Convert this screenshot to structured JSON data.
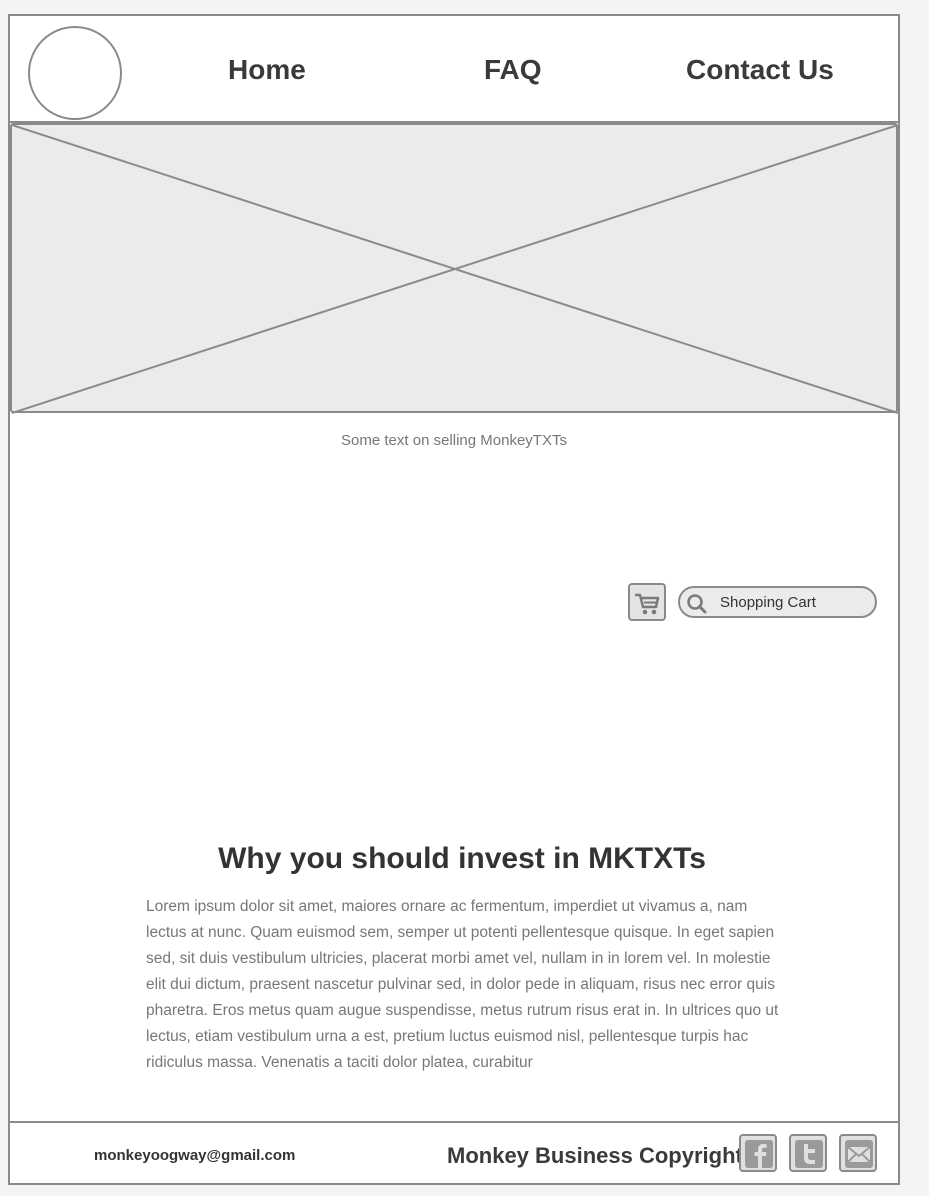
{
  "nav": {
    "items": [
      {
        "label": "Home"
      },
      {
        "label": "FAQ"
      },
      {
        "label": "Contact Us"
      }
    ]
  },
  "hero": {
    "caption": "Some text on selling MonkeyTXTs"
  },
  "shop": {
    "search_value": "Shopping Cart",
    "icons": [
      "shopping-cart-icon",
      "search-icon"
    ]
  },
  "main": {
    "heading": "Why you should invest in MKTXTs",
    "body": "Lorem ipsum dolor sit amet, maiores ornare ac fermentum, imperdiet ut vivamus a, nam lectus at nunc. Quam euismod sem, semper ut potenti pellentesque quisque. In eget sapien sed, sit duis vestibulum ultricies, placerat morbi amet vel, nullam in in lorem vel. In molestie elit dui dictum, praesent nascetur pulvinar sed, in dolor pede in aliquam, risus nec error quis pharetra. Eros metus quam augue suspendisse, metus rutrum risus erat in.  In ultrices quo ut lectus, etiam vestibulum urna a est, pretium luctus euismod nisl, pellentesque turpis hac ridiculus massa. Venenatis a taciti dolor platea, curabitur"
  },
  "footer": {
    "email": "monkeyoogway@gmail.com",
    "copyright": "Monkey Business Copyright",
    "social_icons": [
      "facebook-icon",
      "twitter-icon",
      "email-icon"
    ]
  },
  "colors": {
    "border": "#8a8a8a",
    "placeholder_fill": "#ebebeb",
    "heading_text": "#333333",
    "body_text": "#777777"
  }
}
